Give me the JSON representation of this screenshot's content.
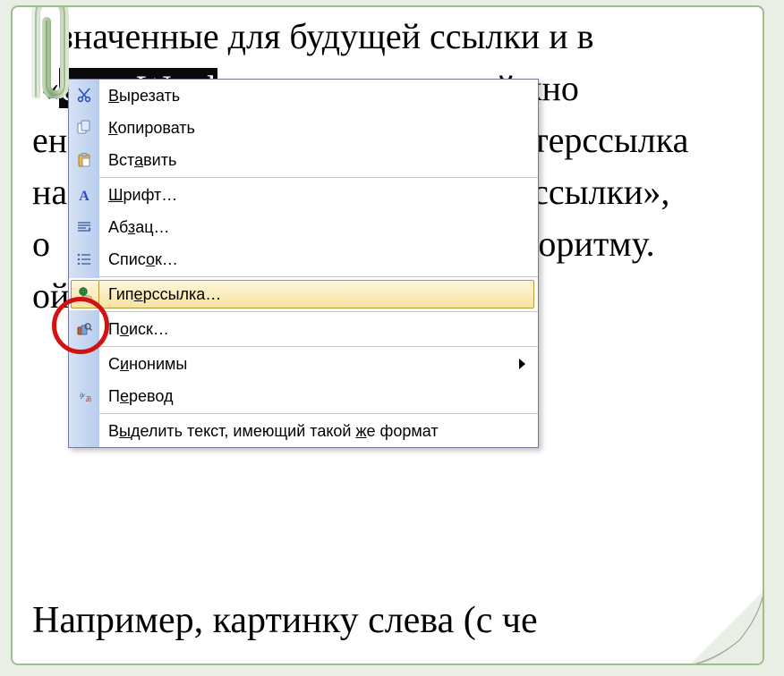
{
  "background_text": {
    "line1_a": "значенные для будущей ссылки и в",
    "line2_sel": "ента Word",
    "line2_b": "» нажимаем правой кно",
    "line3_a": "ен",
    "line3_b": "терссылка",
    "line4_a": "на",
    "line4_b": "ссылки», ",
    "line5_a": "о ",
    "line5_b": "горитму.",
    "line6_a": "ой"
  },
  "menu": {
    "cut": "Вырезать",
    "copy": "Копировать",
    "paste": "Вставить",
    "font": "Шрифт…",
    "paragraph": "Абзац…",
    "list": "Список…",
    "hyperlink": "Гиперссылка…",
    "search": "Поиск…",
    "synonyms": "Синонимы",
    "translate": "Перевод",
    "select_fmt": "Выделить текст, имеющий такой же формат"
  },
  "bottom_line": "Например, картинку слева (с че"
}
